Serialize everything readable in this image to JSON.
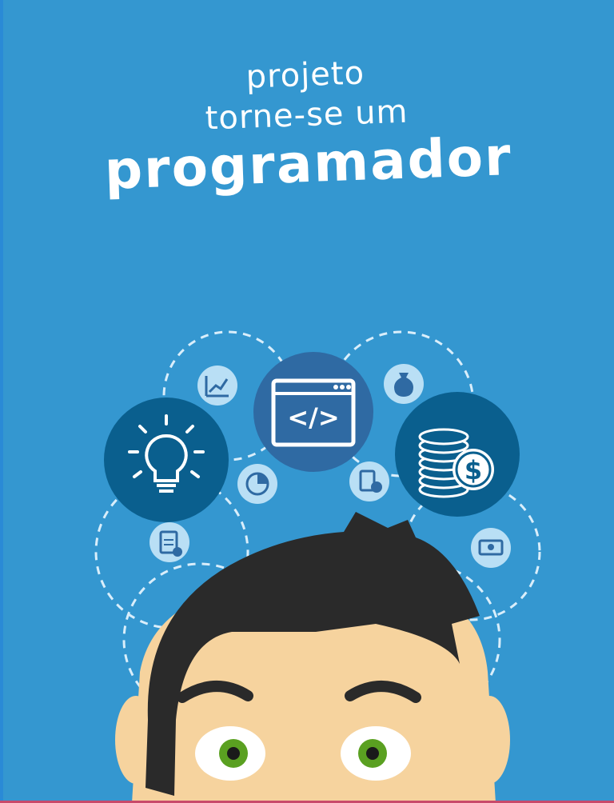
{
  "title": {
    "line1": "projeto",
    "line2": "torne-se um",
    "line3": "programador"
  },
  "code_window": {
    "label": "</>"
  },
  "coin_icon": {
    "label": "$"
  },
  "colors": {
    "background": "#3497d0",
    "icon_circle_dark": "#0a5f8e",
    "icon_circle_mid": "#2f6aa3",
    "small_icon": "#b9dff5",
    "hair": "#2a2a2a",
    "skin": "#f6d39e",
    "eye_iris": "#5aa021"
  },
  "icons": [
    "chart-icon",
    "code-window-icon",
    "money-bag-icon",
    "lightbulb-icon",
    "coins-stack-icon",
    "pie-chart-icon",
    "calculator-icon",
    "clipboard-icon",
    "banknote-icon"
  ]
}
